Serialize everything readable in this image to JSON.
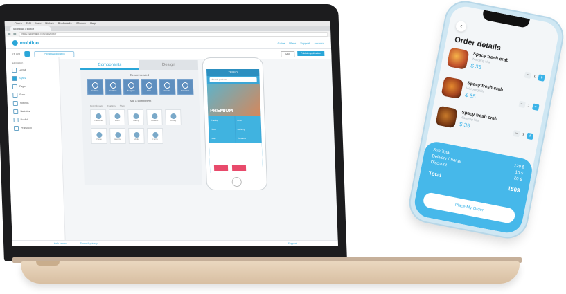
{
  "browser": {
    "menu": [
      "Opera",
      "Edit",
      "View",
      "History",
      "Bookmarks",
      "Window",
      "Help"
    ],
    "tab_title": "Mobiloud / Editor",
    "url": "https://appmaker.com/app/editor"
  },
  "app": {
    "logo": "mobiloo",
    "header_links": [
      "Guide",
      "Plans",
      "Support",
      "Account"
    ],
    "device_label": "IT 001",
    "preview_label": "Preview application",
    "save_label": "Save",
    "publish_label": "Publish application"
  },
  "sidebar": {
    "heading": "Navigation",
    "items": [
      {
        "label": "Layout"
      },
      {
        "label": "Styles"
      },
      {
        "label": "Pages"
      },
      {
        "label": "Push"
      },
      {
        "label": "Settings"
      },
      {
        "label": "Statistics"
      },
      {
        "label": "Publish"
      },
      {
        "label": "Promotion"
      }
    ],
    "active_index": 1
  },
  "editor": {
    "tabs": [
      "Components",
      "Design"
    ],
    "recommended_title": "Recommended",
    "tiles": [
      "Catalog",
      "Contact",
      "Support",
      "Map",
      "Events",
      "Favorites"
    ],
    "add_title": "Add a component",
    "filters": [
      "Recently used",
      "Features",
      "Shop"
    ],
    "components": [
      "Catalogue",
      "Menu",
      "Gallery",
      "Contacts",
      "Loyalty",
      "Phone",
      "Booking",
      "Media",
      "Forms"
    ],
    "footer_left": "Help center",
    "footer_mid": "Terms & privacy",
    "footer_right": "Support"
  },
  "preview": {
    "title": "ZEPRO",
    "search": "Search products",
    "hero": "PREMIUM",
    "cells": [
      "Catalog",
      "News",
      "Shop",
      "Delivery",
      "Map",
      "Contacts"
    ]
  },
  "phone": {
    "title": "Order details",
    "back_icon": "chevron-left-icon",
    "items": [
      {
        "name": "Spacy fresh crab",
        "sub": "Waroeng kita",
        "price": "$ 35",
        "qty": "1"
      },
      {
        "name": "Spacy fresh crab",
        "sub": "Waroeng kita",
        "price": "$ 35",
        "qty": "1"
      },
      {
        "name": "Spacy fresh crab",
        "sub": "Waroeng kita",
        "price": "$ 35",
        "qty": "1"
      }
    ],
    "summary": {
      "sub_total_label": "Sub Total",
      "sub_total_value": "120 $",
      "delivery_label": "Delivery Charge",
      "delivery_value": "10 $",
      "discount_label": "Discount",
      "discount_value": "20 $",
      "total_label": "Total",
      "total_value": "150$"
    },
    "order_button": "Place My Order",
    "accent_color": "#46b8ea"
  }
}
